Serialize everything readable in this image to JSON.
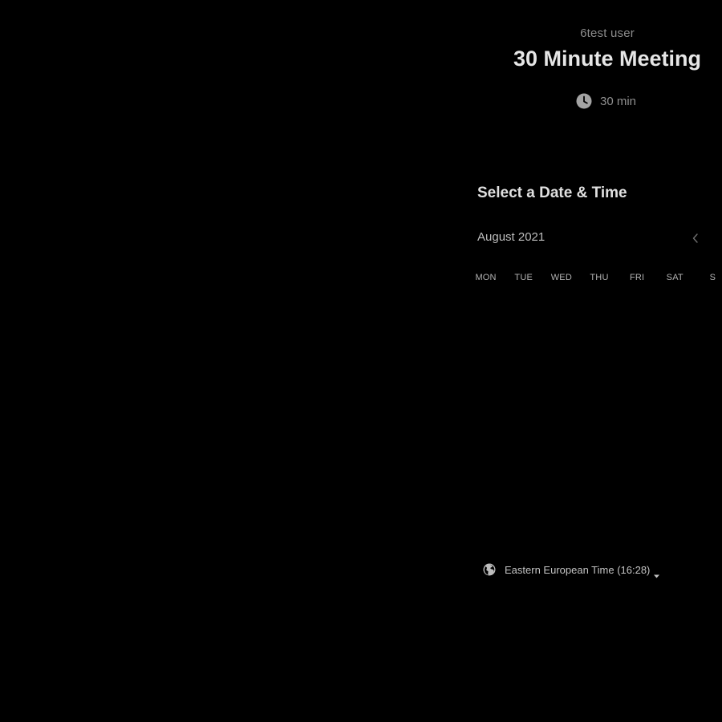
{
  "header": {
    "host_name": "6test user",
    "event_title": "30 Minute Meeting",
    "duration_label": "30 min",
    "duration_icon": "clock-icon"
  },
  "calendar": {
    "section_title": "Select a Date & Time",
    "month_label": "August 2021",
    "prev_icon": "chevron-left-icon",
    "weekdays": [
      "MON",
      "TUE",
      "WED",
      "THU",
      "FRI",
      "SAT",
      "S"
    ]
  },
  "timezone": {
    "label": "Eastern European Time (16:28)",
    "icon": "globe-icon",
    "caret_icon": "caret-down-icon"
  },
  "colors": {
    "background": "#000000",
    "title_text": "#e6e6e6",
    "muted_text": "#8c8c8c"
  }
}
